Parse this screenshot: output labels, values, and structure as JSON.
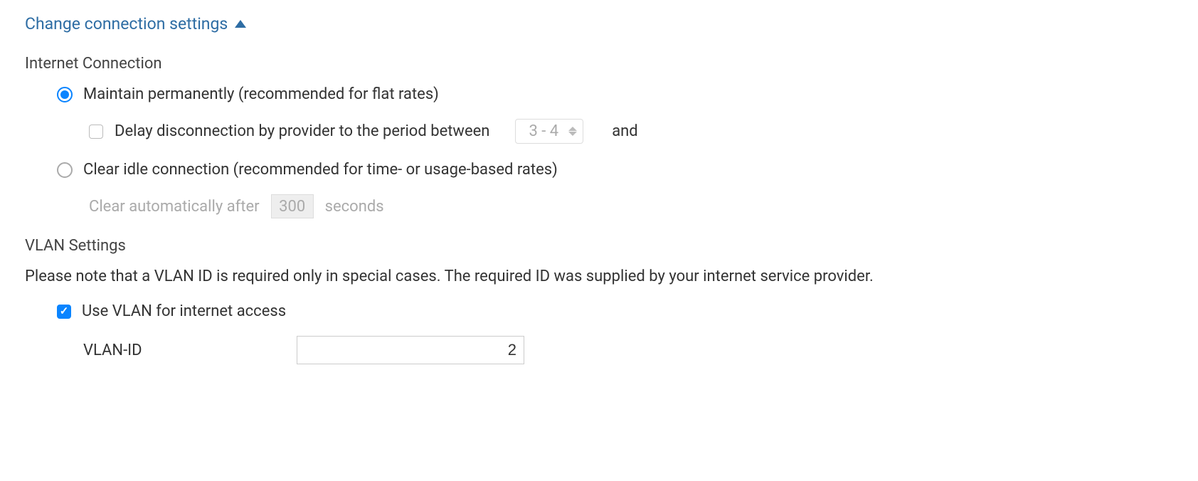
{
  "header": {
    "title": "Change connection settings"
  },
  "internet": {
    "heading": "Internet Connection",
    "maintain": {
      "label": "Maintain permanently (recommended for flat rates)",
      "delay_label": "Delay disconnection by provider to the period between",
      "delay_value": "3 - 4",
      "and_text": "and"
    },
    "clear": {
      "label": "Clear idle connection (recommended for time- or usage-based rates)",
      "auto_prefix": "Clear automatically after",
      "auto_value": "300",
      "auto_suffix": "seconds"
    }
  },
  "vlan": {
    "heading": "VLAN Settings",
    "note": "Please note that a VLAN ID is required only in special cases. The required ID was supplied by your internet service provider.",
    "use_label": "Use VLAN for internet access",
    "id_label": "VLAN-ID",
    "id_value": "2"
  }
}
